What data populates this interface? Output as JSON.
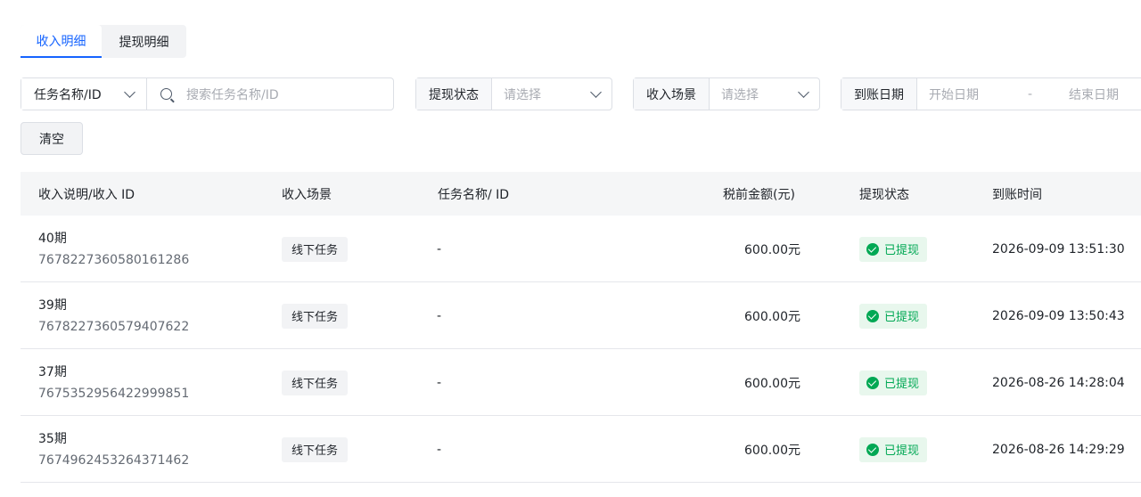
{
  "tabs": [
    {
      "label": "收入明细",
      "active": true
    },
    {
      "label": "提现明细",
      "active": false
    }
  ],
  "filters": {
    "task_type_label": "任务名称/ID",
    "search_placeholder": "搜索任务名称/ID",
    "withdraw_status_label": "提现状态",
    "withdraw_status_placeholder": "请选择",
    "income_scene_label": "收入场景",
    "income_scene_placeholder": "请选择",
    "arrival_date_label": "到账日期",
    "start_date_placeholder": "开始日期",
    "date_separator": "-",
    "end_date_placeholder": "结束日期",
    "clear_label": "清空"
  },
  "table": {
    "headers": {
      "desc": "收入说明/收入 ID",
      "scene": "收入场景",
      "task": "任务名称/ ID",
      "amount": "税前金额(元)",
      "status": "提现状态",
      "time": "到账时间"
    },
    "rows": [
      {
        "title": "40期",
        "id": "7678227360580161286",
        "scene": "线下任务",
        "task": "-",
        "amount": "600.00元",
        "status": "已提现",
        "time": "2026-09-09 13:51:30"
      },
      {
        "title": "39期",
        "id": "7678227360579407622",
        "scene": "线下任务",
        "task": "-",
        "amount": "600.00元",
        "status": "已提现",
        "time": "2026-09-09 13:50:43"
      },
      {
        "title": "37期",
        "id": "7675352956422999851",
        "scene": "线下任务",
        "task": "-",
        "amount": "600.00元",
        "status": "已提现",
        "time": "2026-08-26 14:28:04"
      },
      {
        "title": "35期",
        "id": "7674962453264371462",
        "scene": "线下任务",
        "task": "-",
        "amount": "600.00元",
        "status": "已提现",
        "time": "2026-08-26 14:29:29"
      }
    ]
  },
  "colors": {
    "accent": "#1664ff",
    "success": "#00a854",
    "success_bg": "#e8f7ed"
  }
}
